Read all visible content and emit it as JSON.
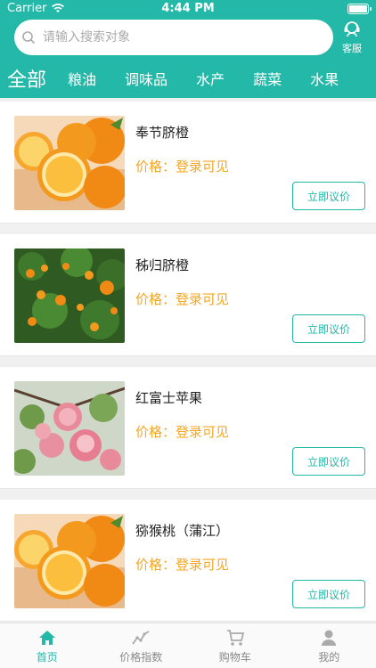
{
  "status": {
    "carrier": "Carrier",
    "time": "4:44 PM"
  },
  "search": {
    "placeholder": "请输入搜索对象"
  },
  "service": {
    "label": "客服"
  },
  "tabs": [
    "全部",
    "粮油",
    "调味品",
    "水产",
    "蔬菜",
    "水果"
  ],
  "products": [
    {
      "name": "奉节脐橙",
      "price_label": "价格：",
      "price_value": "登录可见",
      "button": "立即议价",
      "image": "orange-slices"
    },
    {
      "name": "秭归脐橙",
      "price_label": "价格：",
      "price_value": "登录可见",
      "button": "立即议价",
      "image": "orange-tree"
    },
    {
      "name": "红富士苹果",
      "price_label": "价格：",
      "price_value": "登录可见",
      "button": "立即议价",
      "image": "apple-tree"
    },
    {
      "name": "猕猴桃（蒲江）",
      "price_label": "价格：",
      "price_value": "登录可见",
      "button": "立即议价",
      "image": "orange-slices"
    }
  ],
  "tabbar": [
    {
      "label": "首页",
      "icon": "home-icon",
      "active": true
    },
    {
      "label": "价格指数",
      "icon": "chart-icon",
      "active": false
    },
    {
      "label": "购物车",
      "icon": "cart-icon",
      "active": false
    },
    {
      "label": "我的",
      "icon": "user-icon",
      "active": false
    }
  ],
  "colors": {
    "primary": "#23b8a8",
    "price": "#f5a623"
  }
}
